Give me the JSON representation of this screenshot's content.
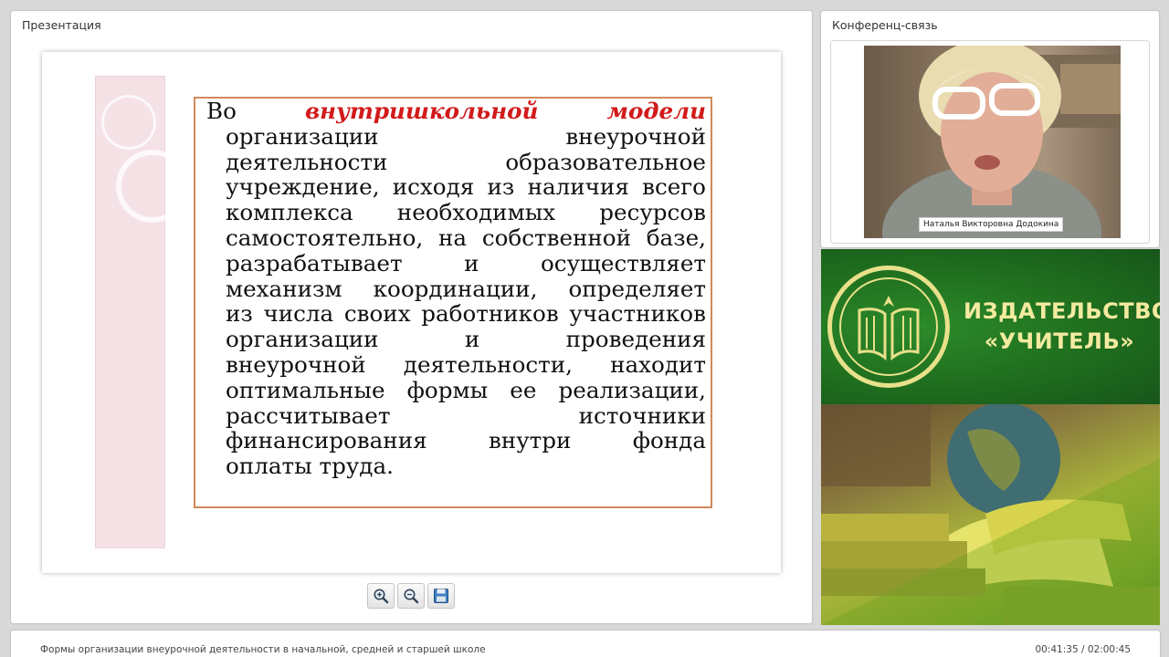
{
  "presentation": {
    "title": "Презентация",
    "slide": {
      "lead_word": "Во",
      "highlight_1": "внутришкольной",
      "highlight_2": "модели",
      "lines": [
        [
          "организации",
          "внеурочной"
        ],
        [
          "деятельности",
          "образовательное"
        ],
        [
          "учреждение,",
          "исходя",
          "из",
          "наличия",
          "всего"
        ],
        [
          "комплекса",
          "необходимых",
          "ресурсов"
        ],
        [
          "самостоятельно,",
          "на",
          "собственной",
          "базе,"
        ],
        [
          "разрабатывает",
          "и",
          "осуществляет"
        ],
        [
          "механизм",
          "координации,",
          "определяет"
        ],
        [
          "из",
          "числа",
          "своих",
          "работников",
          "участников"
        ],
        [
          "организации",
          "и",
          "проведения"
        ],
        [
          "внеурочной",
          "деятельности,",
          "находит"
        ],
        [
          "оптимальные",
          "формы",
          "ее",
          "реализации,"
        ],
        [
          "рассчитывает",
          "источники"
        ],
        [
          "финансирования",
          "внутри",
          "фонда"
        ]
      ],
      "last_line": "оплаты труда."
    },
    "toolbar": {
      "zoom_in_icon": "zoom-in-icon",
      "zoom_out_icon": "zoom-out-icon",
      "save_icon": "floppy-disk-icon"
    }
  },
  "conference": {
    "title": "Конференц-связь",
    "participant_name": "Наталья Викторовна Додокина"
  },
  "publisher": {
    "name_line1": "ИЗДАТЕЛЬСТВО",
    "name_line2": "«УЧИТЕЛЬ»"
  },
  "footer": {
    "title": "Формы организации внеурочной деятельности в начальной, средней и старшей школе",
    "time": "00:41:35 / 02:00:45"
  },
  "colors": {
    "highlight": "#d21a1a",
    "slide_border": "#d08a5b",
    "banner_green": "#1f6d1e",
    "banner_gold": "#f3eaa0"
  }
}
